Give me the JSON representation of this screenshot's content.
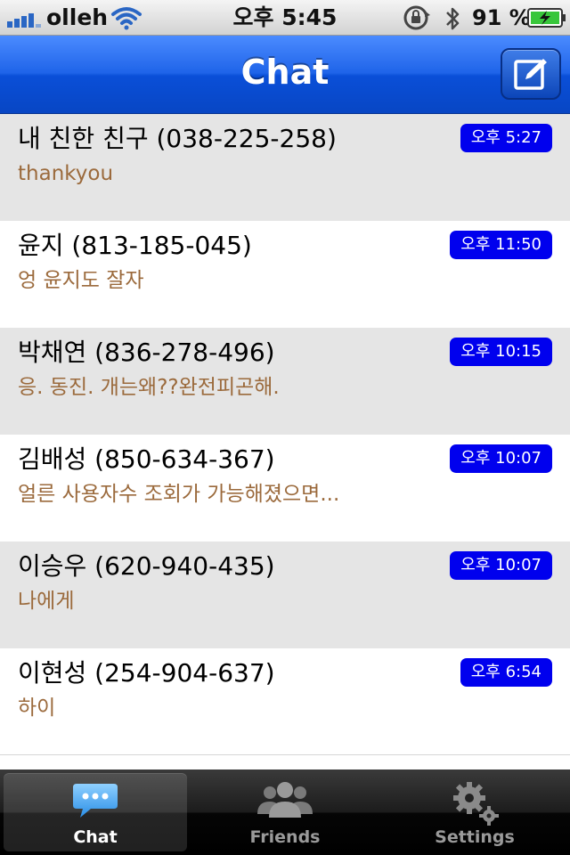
{
  "status_bar": {
    "carrier": "olleh",
    "time": "오후 5:45",
    "battery_percent": "91 %",
    "icons": [
      "signal-bars-icon",
      "wifi-icon",
      "rotation-lock-icon",
      "bluetooth-icon",
      "battery-charging-icon"
    ]
  },
  "nav_bar": {
    "title": "Chat",
    "compose_icon": "compose-icon"
  },
  "chats": [
    {
      "name": "내 친한 친구 (038-225-258)",
      "preview": "thankyou",
      "time": "오후 5:27"
    },
    {
      "name": "윤지 (813-185-045)",
      "preview": "엉 윤지도 잘자",
      "time": "오후 11:50"
    },
    {
      "name": "박채연 (836-278-496)",
      "preview": "응. 동진. 개는왜??완전피곤해.",
      "time": "오후 10:15"
    },
    {
      "name": "김배성 (850-634-367)",
      "preview": "얼른 사용자수 조회가 가능해졌으면...",
      "time": "오후 10:07"
    },
    {
      "name": "이승우 (620-940-435)",
      "preview": "나에게",
      "time": "오후 10:07"
    },
    {
      "name": "이현성 (254-904-637)",
      "preview": "하이",
      "time": "오후 6:54"
    }
  ],
  "tab_bar": {
    "tabs": [
      {
        "label": "Chat",
        "icon": "chat-bubble-icon",
        "active": true
      },
      {
        "label": "Friends",
        "icon": "friends-icon",
        "active": false
      },
      {
        "label": "Settings",
        "icon": "gears-icon",
        "active": false
      }
    ]
  },
  "colors": {
    "nav_blue": "#1f64e9",
    "badge_blue": "#0000ee",
    "preview_brown": "#9b6a3c",
    "row_shaded": "#e5e5e5"
  }
}
